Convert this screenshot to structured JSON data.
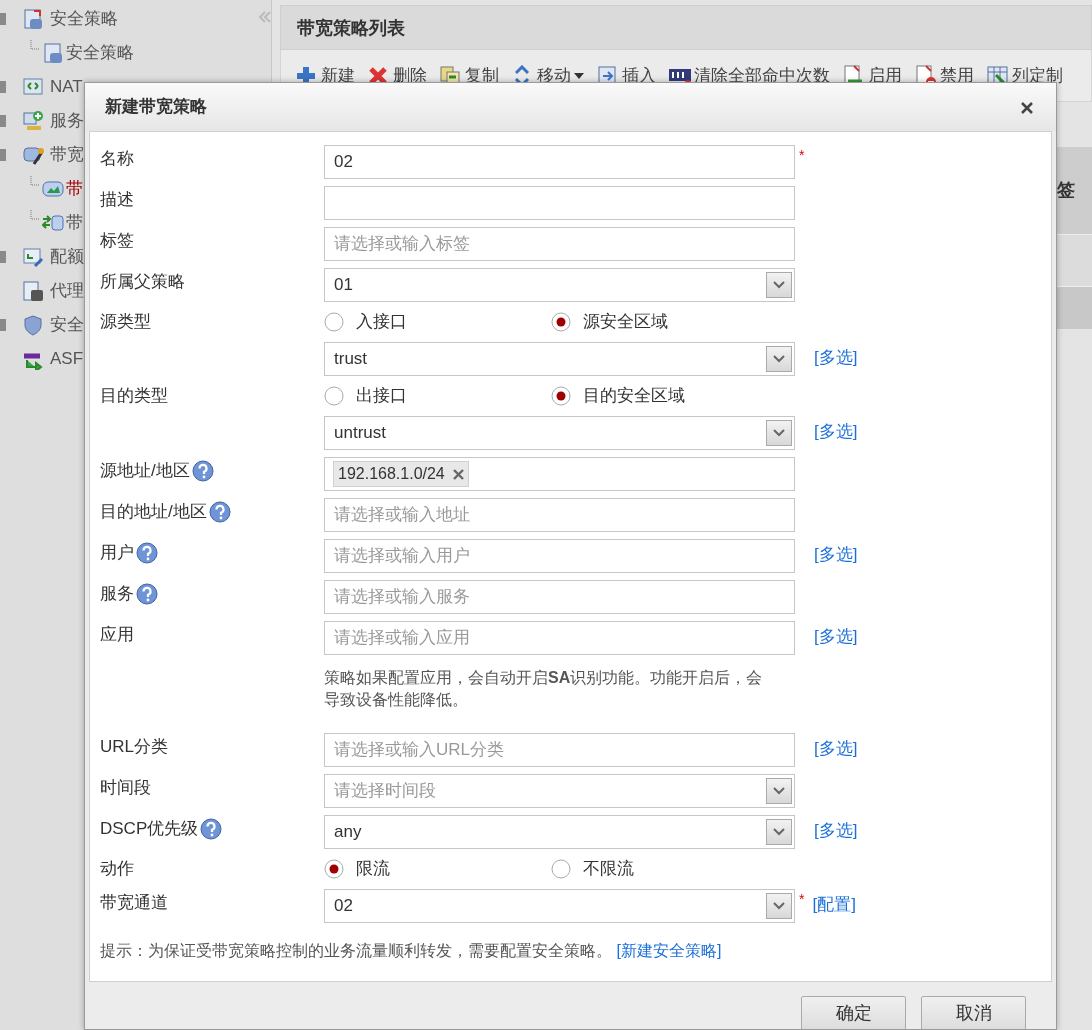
{
  "sidebar": {
    "items": [
      {
        "label": "安全策略",
        "has_toggle": true,
        "children": [
          {
            "label": "安全策略",
            "selected": false
          }
        ]
      },
      {
        "label": "NAT",
        "has_toggle": true
      },
      {
        "label": "服务",
        "has_toggle": true
      },
      {
        "label": "带宽",
        "has_toggle": true,
        "children": [
          {
            "label": "带",
            "selected": true
          },
          {
            "label": "带",
            "selected": false
          }
        ]
      },
      {
        "label": "配额",
        "has_toggle": true
      },
      {
        "label": "代理",
        "has_toggle": false
      },
      {
        "label": "安全",
        "has_toggle": true
      },
      {
        "label": "ASF",
        "has_toggle": false
      }
    ]
  },
  "main": {
    "title": "带宽策略列表",
    "toolbar": [
      {
        "label": "新建",
        "dropdown": false
      },
      {
        "label": "删除",
        "dropdown": false
      },
      {
        "label": "复制",
        "dropdown": false
      },
      {
        "label": "移动",
        "dropdown": true
      },
      {
        "label": "插入",
        "dropdown": false
      },
      {
        "label": "清除全部命中次数",
        "dropdown": false
      },
      {
        "label": "启用",
        "dropdown": false
      },
      {
        "label": "禁用",
        "dropdown": false
      },
      {
        "label": "列定制",
        "dropdown": false
      }
    ],
    "table": {
      "column_header": "签"
    }
  },
  "dialog": {
    "title": "新建带宽策略",
    "rows": [
      {
        "kind": "text",
        "label": "名称",
        "value": "02",
        "required_mark": "*"
      },
      {
        "kind": "text",
        "label": "描述"
      },
      {
        "kind": "text",
        "label": "标签",
        "placeholder": "请选择或输入标签"
      },
      {
        "kind": "select",
        "label": "所属父策略",
        "value": "01"
      },
      {
        "kind": "radio",
        "label": "源类型",
        "options": [
          {
            "label": "入接口",
            "selected": false
          },
          {
            "label": "源安全区域",
            "selected": true
          }
        ]
      },
      {
        "kind": "select",
        "value": "trust",
        "link": "[多选]"
      },
      {
        "kind": "radio",
        "label": "目的类型",
        "options": [
          {
            "label": "出接口",
            "selected": false
          },
          {
            "label": "目的安全区域",
            "selected": true
          }
        ]
      },
      {
        "kind": "select",
        "value": "untrust",
        "link": "[多选]"
      },
      {
        "kind": "tags",
        "label": "源地址/地区",
        "help": true,
        "tags": [
          "192.168.1.0/24"
        ]
      },
      {
        "kind": "text",
        "label": "目的地址/地区",
        "help": true,
        "placeholder": "请选择或输入地址"
      },
      {
        "kind": "text",
        "label": "用户",
        "help": true,
        "placeholder": "请选择或输入用户",
        "link": "[多选]"
      },
      {
        "kind": "text",
        "label": "服务",
        "help": true,
        "placeholder": "请选择或输入服务"
      },
      {
        "kind": "text",
        "label": "应用",
        "placeholder": "请选择或输入应用",
        "link": "[多选]"
      },
      {
        "kind": "note",
        "text": "策略如果配置应用，会自动开启**SA**识别功能。功能开启后，会导致设备性能降低。"
      },
      {
        "kind": "text",
        "label": "URL分类",
        "placeholder": "请选择或输入URL分类",
        "link": "[多选]"
      },
      {
        "kind": "select",
        "label": "时间段",
        "placeholder": "请选择时间段"
      },
      {
        "kind": "select",
        "label": "DSCP优先级",
        "help": true,
        "value": "any",
        "link": "[多选]"
      },
      {
        "kind": "radio",
        "label": "动作",
        "options": [
          {
            "label": "限流",
            "selected": true
          },
          {
            "label": "不限流",
            "selected": false
          }
        ]
      },
      {
        "kind": "select",
        "label": "带宽通道",
        "value": "02",
        "required_mark": "*",
        "link": "[配置]"
      }
    ],
    "hint": {
      "text": "提示：为保证受带宽策略控制的业务流量顺利转发，需要配置安全策略。",
      "link": "[新建安全策略]"
    },
    "buttons": [
      "确定",
      "取消"
    ]
  }
}
